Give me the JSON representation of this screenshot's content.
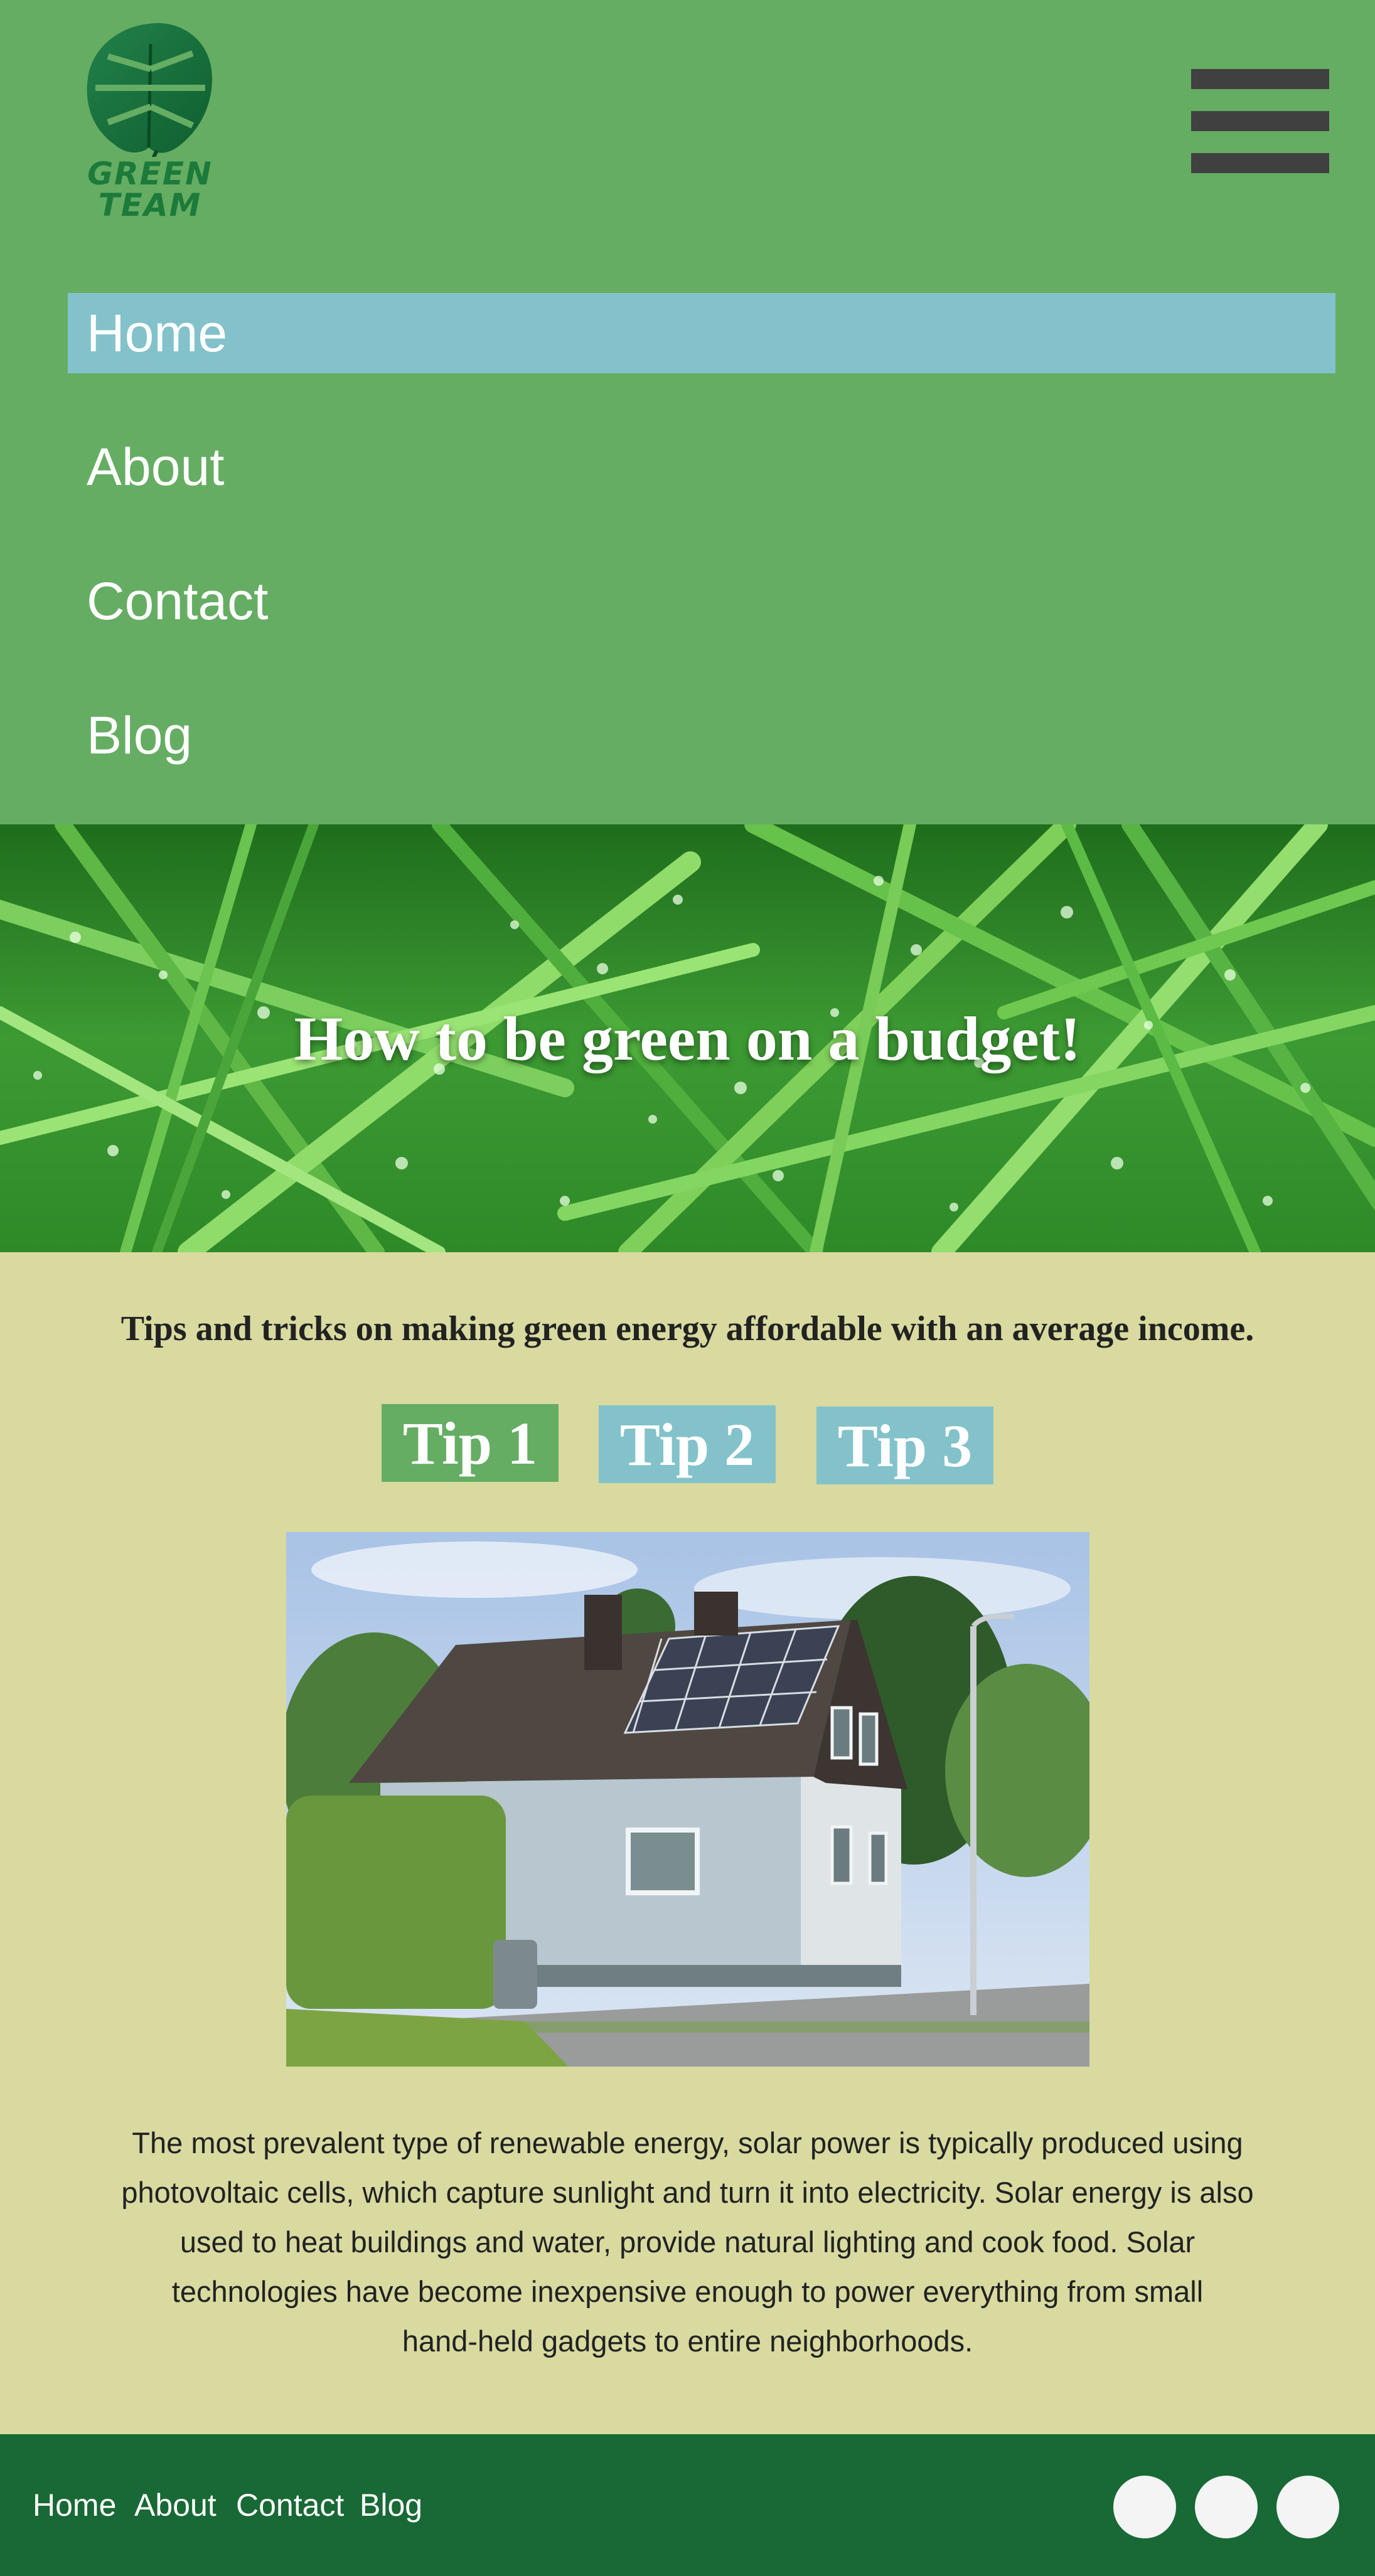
{
  "brand": {
    "logo_line1": "GREEN",
    "logo_line2": "TEAM",
    "logo_icon": "monstera-leaf-icon"
  },
  "nav": {
    "menu_icon": "hamburger-menu-icon",
    "items": [
      {
        "label": "Home",
        "active": true
      },
      {
        "label": "About",
        "active": false
      },
      {
        "label": "Contact",
        "active": false
      },
      {
        "label": "Blog",
        "active": false
      }
    ]
  },
  "hero": {
    "title": "How to be green on a budget!"
  },
  "main": {
    "subtitle": "Tips and tricks on making green energy affordable with an average income.",
    "tabs": [
      {
        "label": "Tip 1",
        "active": true
      },
      {
        "label": "Tip 2",
        "active": false
      },
      {
        "label": "Tip 3",
        "active": false
      }
    ],
    "body_lines": [
      "The most prevalent type of renewable energy, solar power is typically produced using",
      "photovoltaic cells, which capture sunlight and turn it into electricity. Solar energy is also",
      "used to heat buildings and water, provide natural lighting and cook food. Solar",
      "technologies have become inexpensive enough to power everything from small",
      "hand-held gadgets to entire neighborhoods."
    ]
  },
  "footer": {
    "links": [
      "Home",
      "About",
      "Contact",
      "Blog"
    ]
  },
  "colors": {
    "header_green": "#65ad63",
    "active_nav": "#83c2ca",
    "content_bg": "#d8daa0",
    "footer_green": "#186935",
    "hamburger": "#404040"
  }
}
